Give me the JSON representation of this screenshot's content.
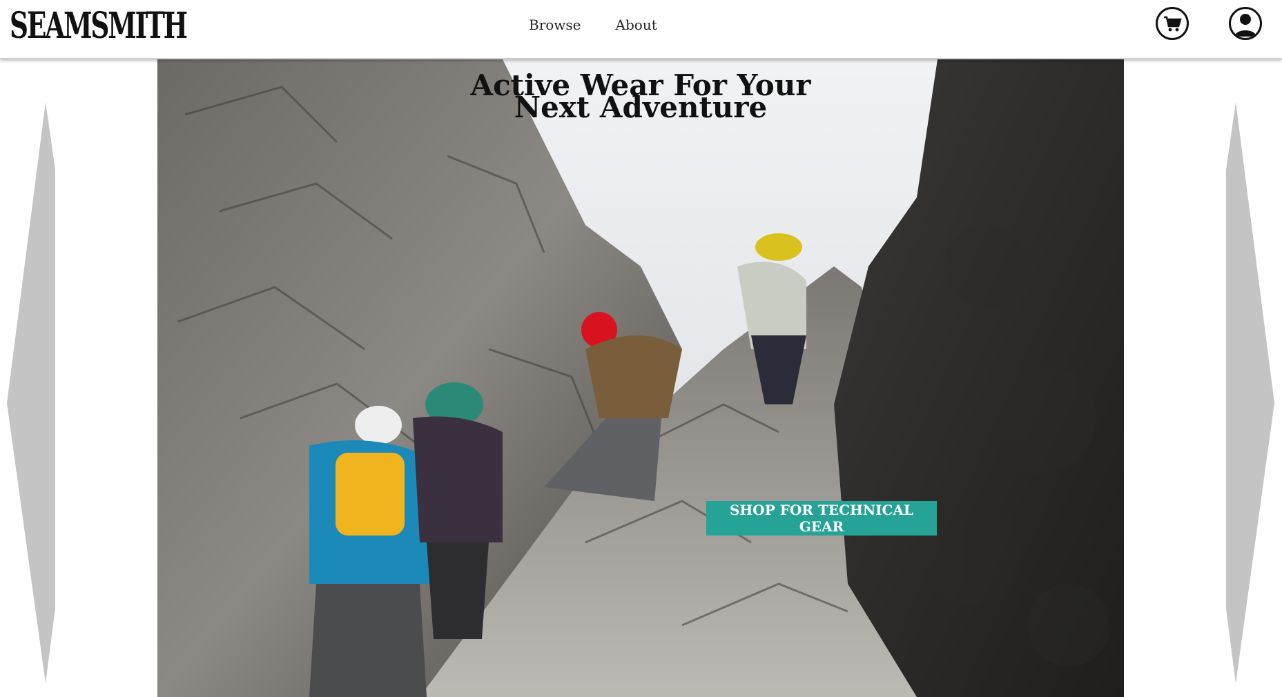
{
  "brand": {
    "logo_text": "SEAMSMITH"
  },
  "nav": {
    "items": [
      "Browse",
      "About"
    ]
  },
  "header_icons": {
    "cart": "shopping-cart-icon",
    "account": "user-account-icon"
  },
  "hero": {
    "title_line1": "Active Wear For Your",
    "title_line2": "Next Adventure",
    "cta_label": "SHOP FOR TECHNICAL GEAR",
    "image_subject": "climbers-on-rocky-ridge"
  },
  "carousel": {
    "prev_icon": "chevron-left-icon",
    "next_icon": "chevron-right-icon"
  },
  "colors": {
    "accent": "#26a397",
    "arrow": "#c4c4c4",
    "text": "#111111"
  }
}
